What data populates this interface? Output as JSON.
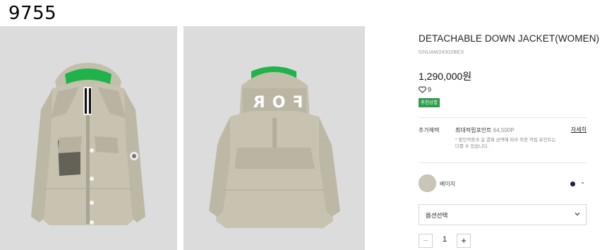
{
  "corner_label": "9755",
  "product": {
    "title": "DETACHABLE DOWN JACKET(WOMEN)",
    "code": "GNUAW24302BEX",
    "price": "1,290,000원",
    "likes": "9",
    "badge": "추천상품",
    "hood_lettering": "FOR"
  },
  "benefit": {
    "label": "추가혜택",
    "main": "최대적립포인트",
    "points": "64,500P",
    "detail_link": "자세히",
    "note": "* 할인적용과 실 결제 금액에 따라 최종 적립 포인트는 다를 수 있습니다."
  },
  "color_option": {
    "swatch_label": "베이지",
    "swatch_color": "#c9c6b6",
    "dot_color": "#1d2140"
  },
  "option_select": {
    "label": "옵션선택"
  },
  "quantity": {
    "minus": "−",
    "value": "1",
    "plus": "+"
  },
  "colors": {
    "badge_green": "#2e9e4a",
    "jacket_beige": "#c4bfad",
    "lining_green": "#1fb34a"
  }
}
